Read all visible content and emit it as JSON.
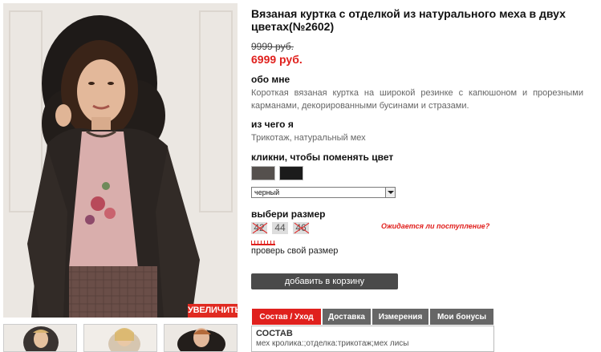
{
  "product": {
    "title": "Вязаная куртка с отделкой из натурального меха в двух цветах(№2602)",
    "old_price": "9999 руб.",
    "new_price": "6999 руб."
  },
  "about": {
    "heading": "обо мне",
    "text": "Короткая вязаная куртка на широкой резинке с капюшоном и прорезными карманами, декорированными бусинами и стразами."
  },
  "material": {
    "heading": "из чего я",
    "text": "Трикотаж, натуральный мех"
  },
  "color": {
    "heading": "кликни, чтобы поменять цвет",
    "swatches": [
      "gray-swatch",
      "black-swatch"
    ],
    "swatch_colors": [
      "#55504d",
      "#1b1b1b"
    ],
    "selected": "черный"
  },
  "size": {
    "heading": "выбери размер",
    "options": [
      {
        "label": "42",
        "available": false
      },
      {
        "label": "44",
        "available": true
      },
      {
        "label": "46",
        "available": false
      }
    ],
    "awaiting_link": "Ожидается ли поступление?",
    "check_link": "проверь свой размер"
  },
  "zoom_label": "УВЕЛИЧИТЬ",
  "cart_button": "добавить в корзину",
  "tabs": [
    {
      "label": "Состав / Уход",
      "active": true
    },
    {
      "label": "Доставка",
      "active": false
    },
    {
      "label": "Измерения",
      "active": false
    },
    {
      "label": "Мои бонусы",
      "active": false
    }
  ],
  "tab_content": {
    "heading": "СОСТАВ",
    "text": "мех кролика:;отделка:трикотаж;мех лисы"
  },
  "colors": {
    "accent": "#e0201d",
    "button_dark": "#4a4a4a",
    "tab_inactive": "#666666"
  }
}
